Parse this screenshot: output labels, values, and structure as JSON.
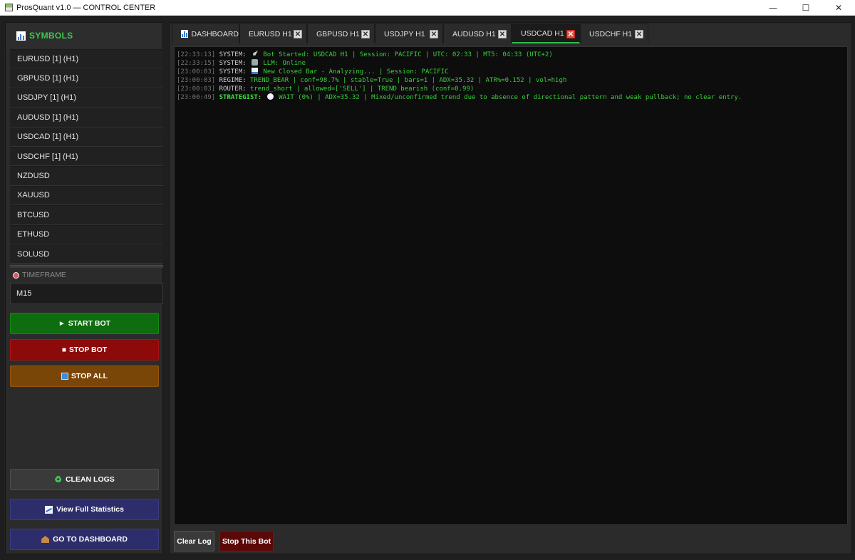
{
  "window": {
    "title": "ProsQuant v1.0 — CONTROL CENTER",
    "controls": {
      "minimize": "—",
      "maximize": "☐",
      "close": "✕"
    }
  },
  "sidebar": {
    "header": "SYMBOLS",
    "symbols": [
      {
        "label": "EURUSD [1] (H1)"
      },
      {
        "label": "GBPUSD [1] (H1)"
      },
      {
        "label": "USDJPY [1] (H1)"
      },
      {
        "label": "AUDUSD [1] (H1)"
      },
      {
        "label": "USDCAD [1] (H1)"
      },
      {
        "label": "USDCHF [1] (H1)"
      },
      {
        "label": "NZDUSD"
      },
      {
        "label": "XAUUSD"
      },
      {
        "label": "BTCUSD"
      },
      {
        "label": "ETHUSD"
      },
      {
        "label": "SOLUSD"
      }
    ],
    "timeframe_label": "TIMEFRAME",
    "timeframe_value": "M15",
    "buttons": {
      "start": "START BOT",
      "stop": "STOP BOT",
      "stop_all": "STOP ALL",
      "clean_logs": "CLEAN LOGS",
      "full_stats": "View Full Statistics",
      "dashboard": "GO TO DASHBOARD"
    },
    "colors": {
      "accent": "#3ec94e",
      "start": "#0e6d0e",
      "stop": "#8c0a0a",
      "stop_all": "#7a4608",
      "nav": "#2d2d6b"
    }
  },
  "tabs": [
    {
      "label": "DASHBOARD",
      "icon": "chart-icon",
      "closable": false,
      "active": false
    },
    {
      "label": "EURUSD H1",
      "closable": true,
      "active": false
    },
    {
      "label": "GBPUSD H1",
      "closable": true,
      "active": false
    },
    {
      "label": "USDJPY H1",
      "closable": true,
      "active": false
    },
    {
      "label": "AUDUSD H1",
      "closable": true,
      "active": false
    },
    {
      "label": "USDCAD H1",
      "closable": true,
      "active": true
    },
    {
      "label": "USDCHF H1",
      "closable": true,
      "active": false
    }
  ],
  "tab_close_glyph": "✕",
  "log": [
    {
      "ts": "[22:33:13]",
      "src": "SYSTEM:",
      "icon": "rocket-icon",
      "msg": "Bot Started: USDCAD H1 | Session: PACIFIC | UTC: 02:33 | MT5: 04:33 (UTC+2)"
    },
    {
      "ts": "[22:33:15]",
      "src": "SYSTEM:",
      "icon": "robot-icon",
      "msg": "LLM: Online"
    },
    {
      "ts": "[23:00:03]",
      "src": "SYSTEM:",
      "icon": "chart-icon",
      "msg": "New Closed Bar - Analyzing... | Session: PACIFIC"
    },
    {
      "ts": "[23:00:03]",
      "src": "REGIME:",
      "icon": "",
      "msg": "TREND_BEAR | conf=98.7% | stable=True | bars=1 | ADX=35.32 | ATR%=0.152 | vol=high"
    },
    {
      "ts": "[23:00:03]",
      "src": "ROUTER:",
      "icon": "",
      "msg": "trend_short | allowed=['SELL'] | TREND bearish (conf=0.99)"
    },
    {
      "ts": "[23:00:49]",
      "src": "STRATEGIST:",
      "icon": "circle-icon",
      "msg": "WAIT (0%) | ADX=35.32 | Mixed/unconfirmed trend due to absence of directional pattern and weak pullback; no clear entry.",
      "bold": true
    }
  ],
  "bottom": {
    "clear_log": "Clear Log",
    "stop_this": "Stop This Bot"
  }
}
